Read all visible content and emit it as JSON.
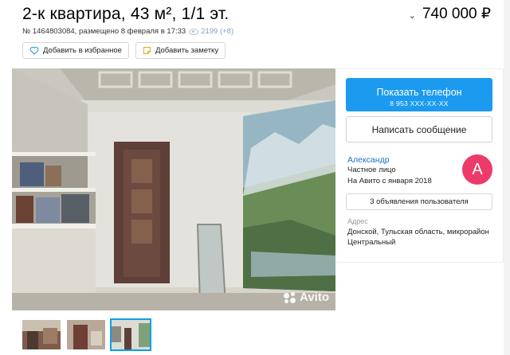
{
  "listing": {
    "title": "2-к квартира, 43 м², 1/1 эт.",
    "price": "740 000 ₽",
    "price_chevron": "⌄",
    "meta_text": "№ 1464803084, размещено 8 февраля в 17:33",
    "views": "2199 (+8)"
  },
  "actions": {
    "favorite_label": "Добавить в избранное",
    "note_label": "Добавить заметку"
  },
  "gallery": {
    "watermark": "Avito",
    "thumbnail_count": 3,
    "active_thumbnail": 3
  },
  "contact": {
    "show_phone_label": "Показать телефон",
    "phone_masked": "8 953 XXX-XX-XX",
    "message_label": "Написать сообщение"
  },
  "seller": {
    "name": "Александр",
    "type": "Частное лицо",
    "since": "На Авито с января 2018",
    "avatar_letter": "А",
    "avatar_color": "#ec3a6a",
    "listings_label": "3 объявления пользователя"
  },
  "address": {
    "label": "Адрес",
    "value": "Донской, Тульская область, микрорайон Центральный"
  },
  "colors": {
    "primary": "#1b9af0",
    "link": "#1a73c9",
    "thumb_active": "#0aa1e6"
  }
}
